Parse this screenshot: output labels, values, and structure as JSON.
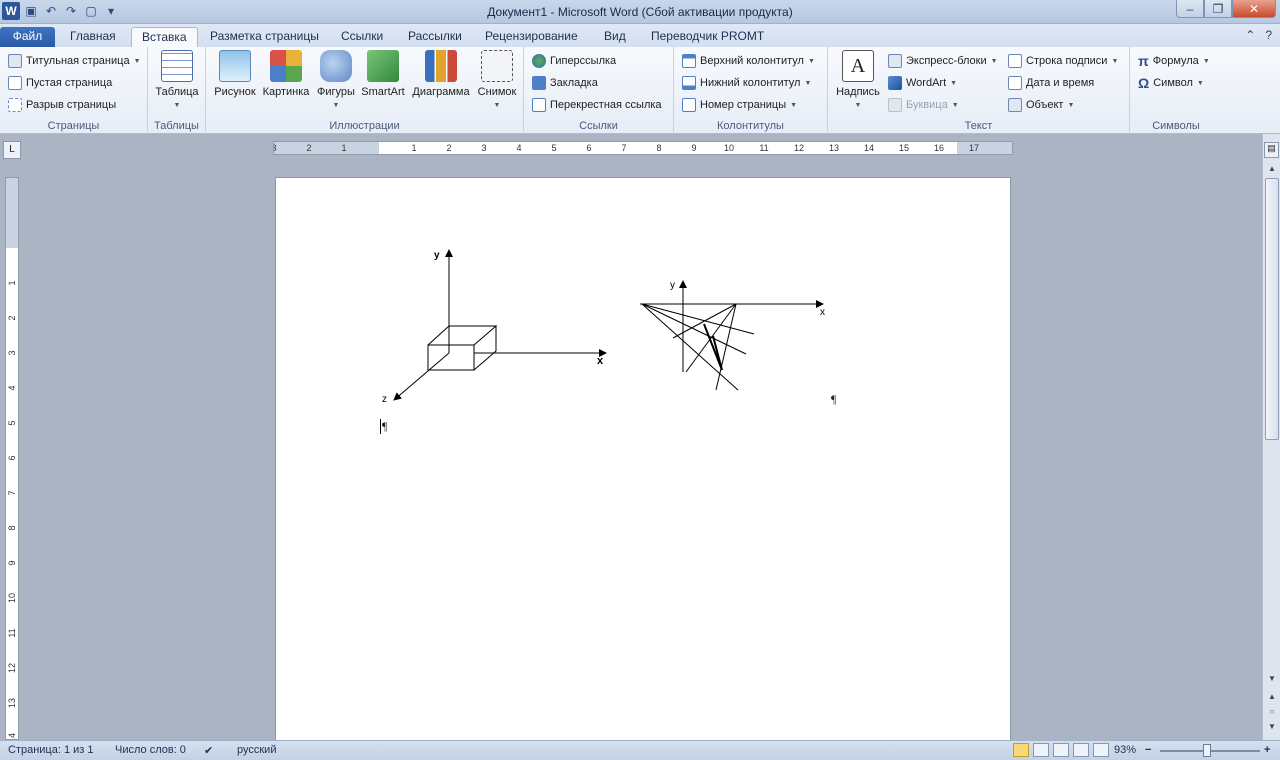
{
  "window": {
    "title": "Документ1  -  Microsoft Word (Сбой активации продукта)",
    "logo": "W"
  },
  "tabs": {
    "file": "Файл",
    "items": [
      "Главная",
      "Вставка",
      "Разметка страницы",
      "Ссылки",
      "Рассылки",
      "Рецензирование",
      "Вид",
      "Переводчик PROMT"
    ],
    "active": "Вставка"
  },
  "ribbon": {
    "pages": {
      "label": "Страницы",
      "cover": "Титульная страница",
      "blank": "Пустая страница",
      "pagebreak": "Разрыв страницы"
    },
    "tables": {
      "label": "Таблицы",
      "table": "Таблица"
    },
    "illustrations": {
      "label": "Иллюстрации",
      "picture": "Рисунок",
      "clipart": "Картинка",
      "shapes": "Фигуры",
      "smartart": "SmartArt",
      "chart": "Диаграмма",
      "screenshot": "Снимок"
    },
    "links": {
      "label": "Ссылки",
      "hyperlink": "Гиперссылка",
      "bookmark": "Закладка",
      "crossref": "Перекрестная ссылка"
    },
    "headerfooter": {
      "label": "Колонтитулы",
      "header": "Верхний колонтитул",
      "footer": "Нижний колонтитул",
      "pagenum": "Номер страницы"
    },
    "text": {
      "label": "Текст",
      "textbox": "Надпись",
      "quickparts": "Экспресс-блоки",
      "wordart": "WordArt",
      "dropcap": "Буквица",
      "signature": "Строка подписи",
      "datetime": "Дата и время",
      "object": "Объект"
    },
    "symbols": {
      "label": "Символы",
      "equation": "Формула",
      "symbol": "Символ",
      "pi": "π",
      "omega": "Ω"
    }
  },
  "ruler": {
    "numbers": [
      "3",
      "2",
      "1",
      "1",
      "2",
      "3",
      "4",
      "5",
      "6",
      "7",
      "8",
      "9",
      "10",
      "11",
      "12",
      "13",
      "14",
      "15",
      "16",
      "17"
    ],
    "vnumbers": [
      "1",
      "2",
      "3",
      "4",
      "5",
      "6",
      "7",
      "8",
      "9",
      "10",
      "11",
      "12",
      "13",
      "14"
    ],
    "tab_selector": "L"
  },
  "document": {
    "left_axes": {
      "y": "y",
      "x": "x",
      "z": "z"
    },
    "right_axes": {
      "y": "y",
      "x": "x"
    },
    "pilcrow": "¶"
  },
  "status": {
    "page": "Страница: 1 из 1",
    "words": "Число слов: 0",
    "language": "русский",
    "zoom": "93%",
    "zoom_minus": "−",
    "zoom_plus": "+"
  }
}
